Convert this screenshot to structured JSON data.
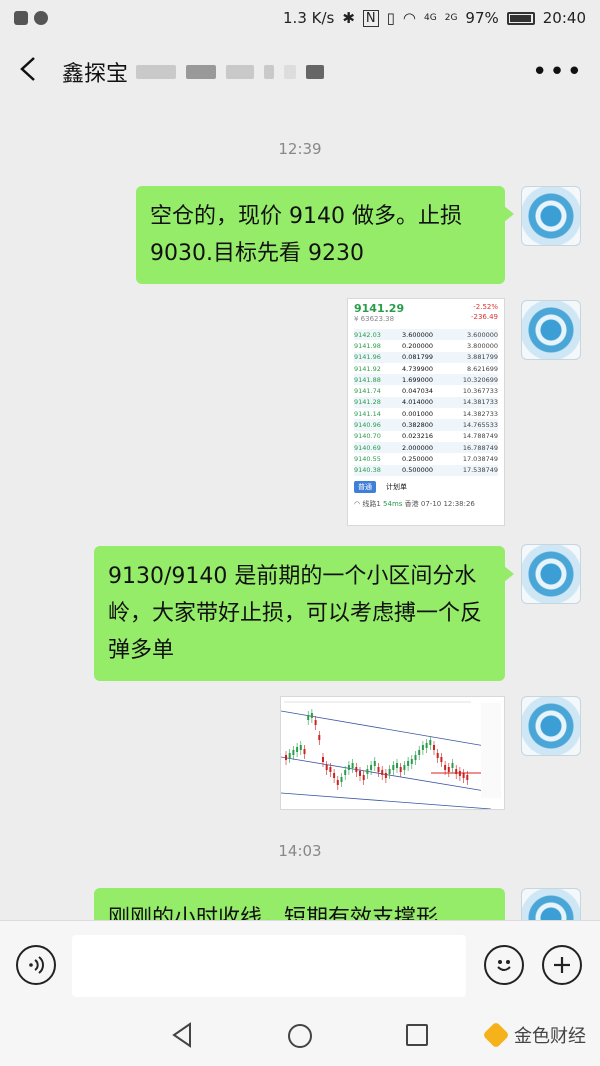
{
  "status_bar": {
    "speed": "1.3 K/s",
    "network_4g": "4G",
    "network_2g": "2G",
    "battery": "97%",
    "time": "20:40"
  },
  "header": {
    "back_icon": "chevron-left-icon",
    "title": "鑫探宝",
    "more_icon": "more-dots-icon",
    "more_label": "•••"
  },
  "messages": {
    "time1": "12:39",
    "msg1": "空仓的，现价 9140 做多。止损 9030.目标先看 9230",
    "msg2": "9130/9140 是前期的一个小区间分水岭，大家带好止损，可以考虑搏一个反弹多单",
    "time2": "14:03",
    "msg3": "刚刚的小时收线，短期有效支撑形"
  },
  "orderbook": {
    "price": "9141.29",
    "change_pct": "-2.52%",
    "change_abs": "-236.49",
    "cny": "¥ 63623.38",
    "rows": [
      {
        "p": "9142.03",
        "q": "3.600000",
        "t": "3.600000"
      },
      {
        "p": "9141.98",
        "q": "0.200000",
        "t": "3.800000"
      },
      {
        "p": "9141.96",
        "q": "0.081799",
        "t": "3.881799"
      },
      {
        "p": "9141.92",
        "q": "4.739900",
        "t": "8.621699"
      },
      {
        "p": "9141.88",
        "q": "1.699000",
        "t": "10.320699"
      },
      {
        "p": "9141.74",
        "q": "0.047034",
        "t": "10.367733"
      },
      {
        "p": "9141.28",
        "q": "4.014000",
        "t": "14.381733"
      },
      {
        "p": "9141.14",
        "q": "0.001000",
        "t": "14.382733"
      },
      {
        "p": "9140.96",
        "q": "0.382800",
        "t": "14.765533"
      },
      {
        "p": "9140.70",
        "q": "0.023216",
        "t": "14.788749"
      },
      {
        "p": "9140.69",
        "q": "2.000000",
        "t": "16.788749"
      },
      {
        "p": "9140.55",
        "q": "0.250000",
        "t": "17.038749"
      },
      {
        "p": "9140.38",
        "q": "0.500000",
        "t": "17.538749"
      }
    ],
    "btn_normal": "普通",
    "btn_plan": "计划单",
    "status_line": "线路1",
    "status_ms": "54ms",
    "status_time": "香港 07-10 12:38:26"
  },
  "input": {
    "voice_icon": "voice-icon",
    "emoji_icon": "emoji-icon",
    "plus_icon": "plus-icon"
  },
  "watermark": {
    "text": "金色财经"
  }
}
